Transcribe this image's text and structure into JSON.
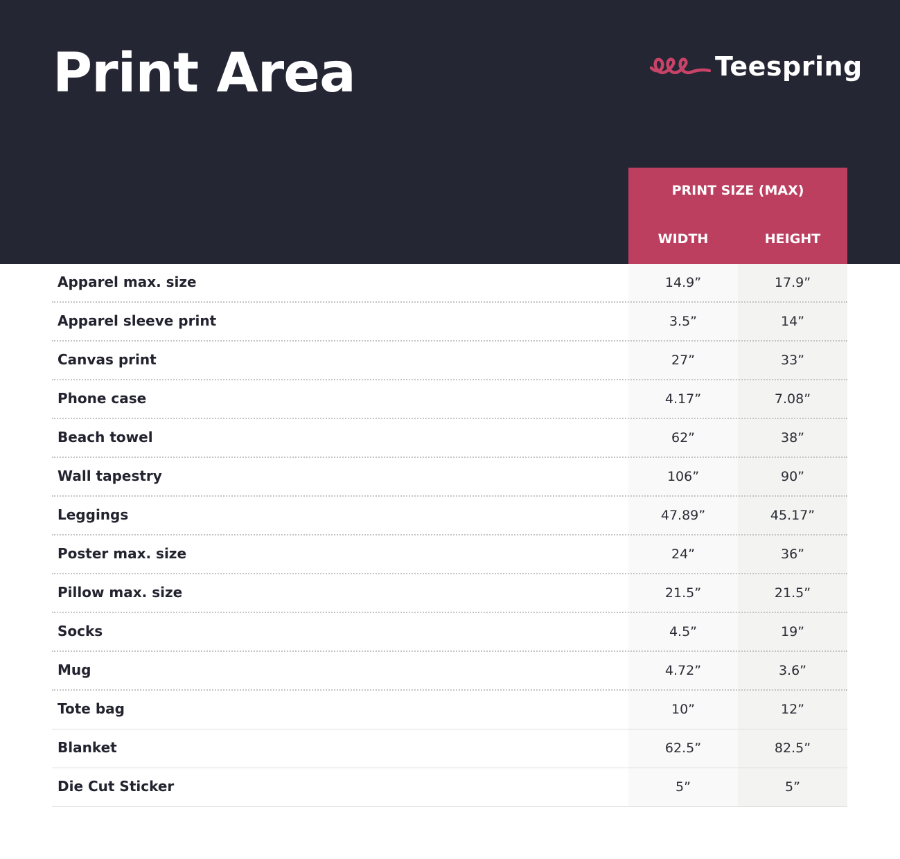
{
  "header": {
    "title": "Print Area",
    "brand": "Teespring",
    "brand_mark_icon": "teespring-loops-logo",
    "colors": {
      "background": "#242634",
      "accent": "#bd3f60",
      "text_light": "#ffffff"
    }
  },
  "table": {
    "group_label": "PRINT SIZE (MAX)",
    "columns": [
      "WIDTH",
      "HEIGHT"
    ],
    "rows": [
      {
        "label": "Apparel max. size",
        "width": "14.9”",
        "height": "17.9”"
      },
      {
        "label": "Apparel sleeve print",
        "width": "3.5”",
        "height": "14”"
      },
      {
        "label": "Canvas print",
        "width": "27”",
        "height": "33”"
      },
      {
        "label": "Phone case",
        "width": "4.17”",
        "height": "7.08”"
      },
      {
        "label": "Beach towel",
        "width": "62”",
        "height": "38”"
      },
      {
        "label": "Wall tapestry",
        "width": "106”",
        "height": "90”"
      },
      {
        "label": "Leggings",
        "width": "47.89”",
        "height": "45.17”"
      },
      {
        "label": "Poster max. size",
        "width": "24”",
        "height": "36”"
      },
      {
        "label": "Pillow max. size",
        "width": "21.5”",
        "height": "21.5”"
      },
      {
        "label": "Socks",
        "width": "4.5”",
        "height": "19”"
      },
      {
        "label": "Mug",
        "width": "4.72”",
        "height": "3.6”"
      },
      {
        "label": "Tote bag",
        "width": "10”",
        "height": "12”"
      },
      {
        "label": "Blanket",
        "width": "62.5”",
        "height": "82.5”"
      },
      {
        "label": "Die Cut Sticker",
        "width": "5”",
        "height": "5”"
      }
    ]
  }
}
